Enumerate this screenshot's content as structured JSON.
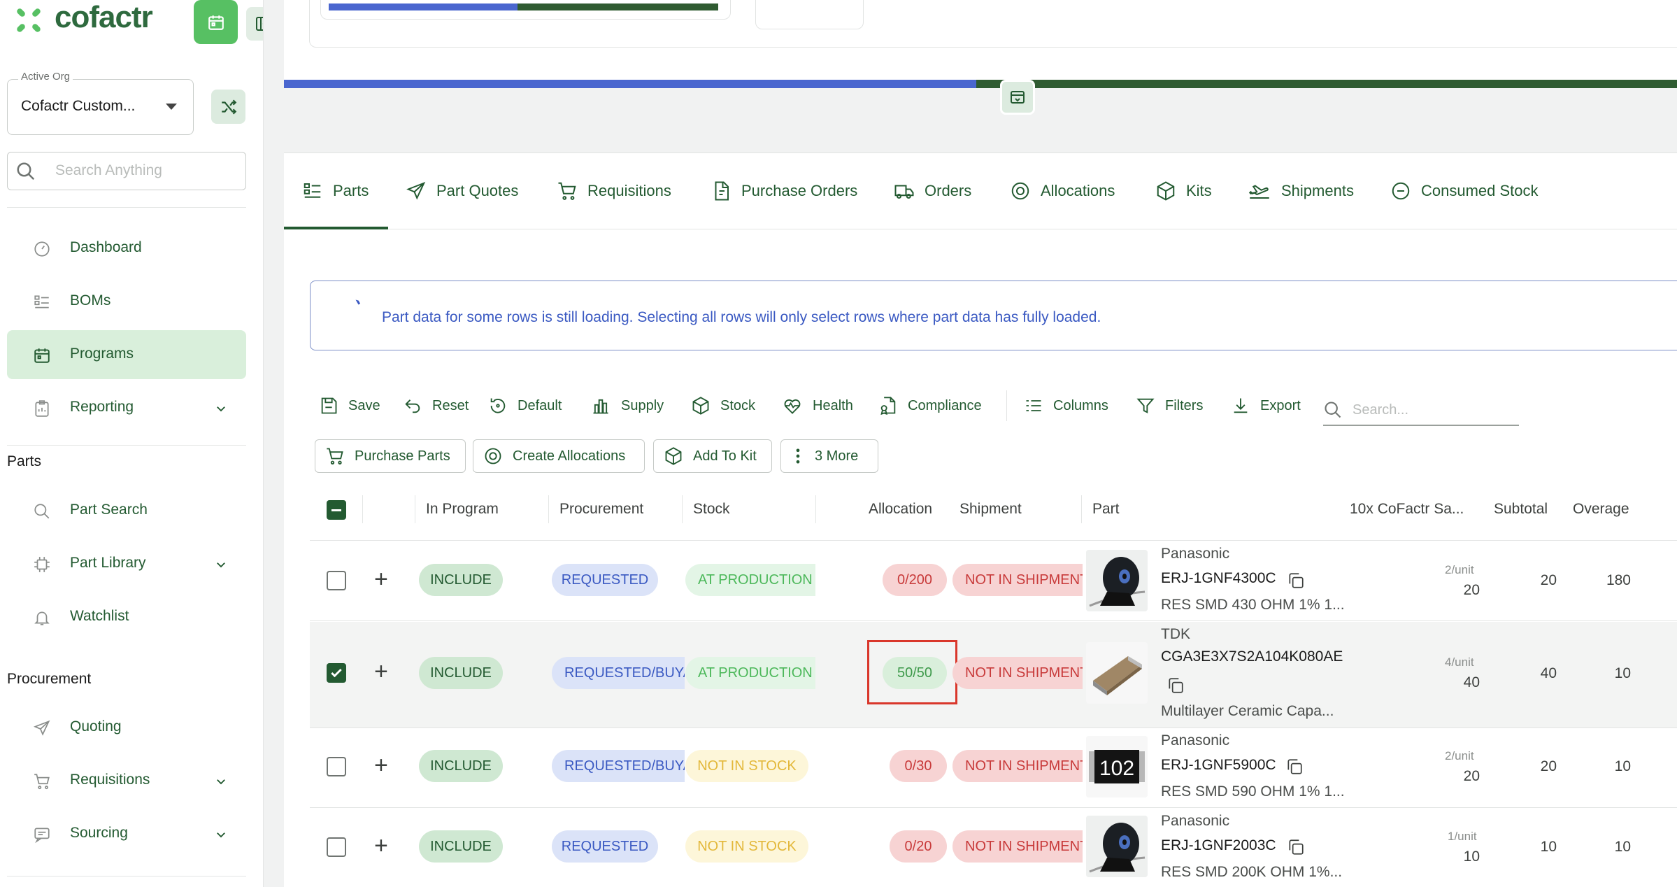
{
  "app": {
    "brand": "cofactr",
    "accent": "#57c063",
    "brand_green": "#235a31"
  },
  "sidebar": {
    "active_org_label": "Active Org",
    "active_org_value": "Cofactr Custom...",
    "search_placeholder": "Search Anything",
    "main_items": [
      {
        "label": "Dashboard",
        "icon": "gauge-icon"
      },
      {
        "label": "BOMs",
        "icon": "list-icon"
      },
      {
        "label": "Programs",
        "icon": "calendar-icon",
        "active": true
      },
      {
        "label": "Reporting",
        "icon": "clipboard-icon",
        "expandable": true
      }
    ],
    "parts_heading": "Parts",
    "parts_items": [
      {
        "label": "Part Search",
        "icon": "search-icon"
      },
      {
        "label": "Part Library",
        "icon": "chip-icon",
        "expandable": true
      },
      {
        "label": "Watchlist",
        "icon": "bell-icon"
      }
    ],
    "procurement_heading": "Procurement",
    "procurement_items": [
      {
        "label": "Quoting",
        "icon": "send-icon"
      },
      {
        "label": "Requisitions",
        "icon": "cart-icon",
        "expandable": true
      },
      {
        "label": "Sourcing",
        "icon": "message-icon",
        "expandable": true
      }
    ]
  },
  "tabs": [
    {
      "label": "Parts",
      "icon": "list-icon",
      "active": true
    },
    {
      "label": "Part Quotes",
      "icon": "send-icon"
    },
    {
      "label": "Requisitions",
      "icon": "cart-icon"
    },
    {
      "label": "Purchase Orders",
      "icon": "document-icon"
    },
    {
      "label": "Orders",
      "icon": "truck-icon"
    },
    {
      "label": "Allocations",
      "icon": "target-icon"
    },
    {
      "label": "Kits",
      "icon": "box-icon"
    },
    {
      "label": "Shipments",
      "icon": "plane-icon"
    },
    {
      "label": "Consumed Stock",
      "icon": "minus-circle-icon"
    }
  ],
  "alert": {
    "text": "Part data for some rows is still loading. Selecting all rows will only select rows where part data has fully loaded."
  },
  "toolbar": {
    "save": "Save",
    "reset": "Reset",
    "default": "Default",
    "supply": "Supply",
    "stock": "Stock",
    "health": "Health",
    "compliance": "Compliance",
    "columns": "Columns",
    "filters": "Filters",
    "export": "Export",
    "search_placeholder": "Search..."
  },
  "actions": {
    "purchase_parts": "Purchase Parts",
    "create_allocations": "Create Allocations",
    "add_to_kit": "Add To Kit",
    "more": "3 More"
  },
  "table": {
    "headers": {
      "in_program": "In Program",
      "procurement": "Procurement",
      "stock": "Stock",
      "allocation": "Allocation",
      "shipment": "Shipment",
      "part": "Part",
      "sample": "10x CoFactr Sa...",
      "subtotal": "Subtotal",
      "overage": "Overage"
    },
    "rows": [
      {
        "selected": false,
        "in_program": "INCLUDE",
        "procurement": "REQUESTED",
        "stock": "AT PRODUCTION (",
        "stock_state": "prod",
        "allocation": "0/200",
        "alloc_state": "red",
        "shipment": "NOT IN SHIPMENT",
        "manufacturer": "Panasonic",
        "mpn": "ERJ-1GNF4300C",
        "description": "RES SMD 430 OHM 1% 1...",
        "per_unit": "2/unit",
        "qty": "20",
        "subtotal": "20",
        "overage": "180",
        "thumb": "reel"
      },
      {
        "selected": true,
        "in_program": "INCLUDE",
        "procurement": "REQUESTED/BUYA",
        "stock": "AT PRODUCTION (",
        "stock_state": "prod",
        "allocation": "50/50",
        "alloc_state": "green",
        "shipment": "NOT IN SHIPMENT",
        "manufacturer": "TDK",
        "mpn": "CGA3E3X7S2A104K080AE",
        "description": "Multilayer Ceramic Capa...",
        "per_unit": "4/unit",
        "qty": "40",
        "subtotal": "40",
        "overage": "10",
        "thumb": "capacitor"
      },
      {
        "selected": false,
        "in_program": "INCLUDE",
        "procurement": "REQUESTED/BUYA",
        "stock": "NOT IN STOCK",
        "stock_state": "none",
        "allocation": "0/30",
        "alloc_state": "red",
        "shipment": "NOT IN SHIPMENT",
        "manufacturer": "Panasonic",
        "mpn": "ERJ-1GNF5900C",
        "description": "RES SMD 590 OHM 1% 1...",
        "per_unit": "2/unit",
        "qty": "20",
        "subtotal": "20",
        "overage": "10",
        "thumb": "resistor",
        "thumb_text": "102"
      },
      {
        "selected": false,
        "in_program": "INCLUDE",
        "procurement": "REQUESTED",
        "stock": "NOT IN STOCK",
        "stock_state": "none",
        "allocation": "0/20",
        "alloc_state": "red",
        "shipment": "NOT IN SHIPMENT",
        "manufacturer": "Panasonic",
        "mpn": "ERJ-1GNF2003C",
        "description": "RES SMD 200K OHM 1%...",
        "per_unit": "1/unit",
        "qty": "10",
        "subtotal": "10",
        "overage": "10",
        "thumb": "reel"
      }
    ]
  }
}
